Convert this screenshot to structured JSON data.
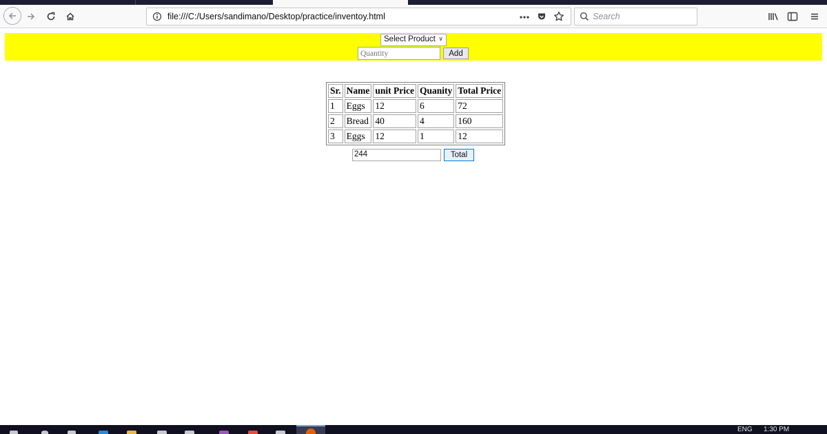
{
  "browser": {
    "url": "file:///C:/Users/sandimano/Desktop/practice/inventoy.html",
    "search_placeholder": "Search",
    "icons": [
      "back-icon",
      "forward-icon",
      "reload-icon",
      "home-icon",
      "info-icon",
      "more-icon",
      "pocket-icon",
      "bookmark-star-icon",
      "library-icon",
      "sidebar-icon",
      "menu-icon"
    ]
  },
  "form": {
    "select_value": "Select Product",
    "quantity_placeholder": "Quantity",
    "add_label": "Add"
  },
  "table": {
    "headers": [
      "Sr.",
      "Name",
      "unit Price",
      "Quanity",
      "Total Price"
    ],
    "rows": [
      [
        "1",
        "Eggs",
        "12",
        "6",
        "72"
      ],
      [
        "2",
        "Bread",
        "40",
        "4",
        "160"
      ],
      [
        "3",
        "Eggs",
        "12",
        "1",
        "12"
      ]
    ]
  },
  "total": {
    "value": "244",
    "button_label": "Total"
  },
  "taskbar": {
    "language": "ENG",
    "time": "1:30 PM"
  }
}
